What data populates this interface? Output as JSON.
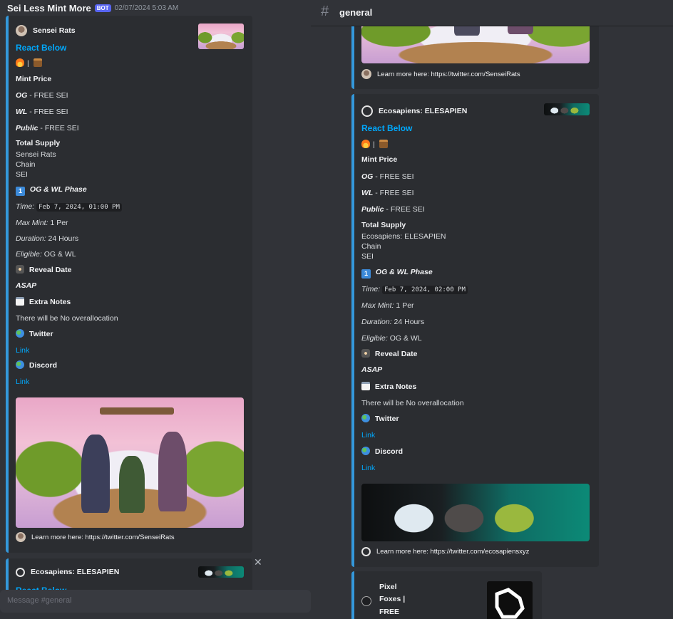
{
  "left_message": {
    "author": "Sei Less Mint More",
    "bot_tag": "BOT",
    "timestamp": "02/07/2024 5:03 AM"
  },
  "left_embed": {
    "author": "Sensei Rats",
    "title": "React Below",
    "reaction_line": "|",
    "mint_price_label": "Mint Price",
    "og_label": "OG",
    "og_value": " - FREE SEI",
    "wl_label": "WL",
    "wl_value": " - FREE SEI",
    "public_label": "Public",
    "public_value": " - FREE SEI",
    "total_supply_label": "Total Supply",
    "supply_lines": [
      "Sensei Rats",
      "Chain",
      "SEI"
    ],
    "phase_number": "1",
    "phase_label": "OG & WL Phase",
    "time_label": "Time:",
    "time_value": "Feb 7, 2024, 01:00 PM",
    "max_mint_label": "Max Mint:",
    "max_mint_value": " 1 Per",
    "duration_label": "Duration:",
    "duration_value": " 24 Hours",
    "eligible_label": "Eligible:",
    "eligible_value": " OG & WL",
    "reveal_label": "Reveal Date",
    "reveal_value": "ASAP",
    "notes_label": "Extra Notes",
    "notes_value": "There will be No overallocation",
    "twitter_label": "Twitter",
    "twitter_link": "Link",
    "discord_label": "Discord",
    "discord_link": "Link",
    "footer": "Learn more here: https://twitter.com/SenseiRats"
  },
  "left_second_embed": {
    "author": "Ecosapiens: ELESAPIEN",
    "title": "React Below"
  },
  "composer": {
    "placeholder": "Message #general"
  },
  "channel": {
    "name": "general"
  },
  "right_top_embed": {
    "footer": "Learn more here: https://twitter.com/SenseiRats"
  },
  "right_embed": {
    "author": "Ecosapiens: ELESAPIEN",
    "title": "React Below",
    "reaction_line": "|",
    "mint_price_label": "Mint Price",
    "og_label": "OG",
    "og_value": " - FREE SEI",
    "wl_label": "WL",
    "wl_value": " - FREE SEI",
    "public_label": "Public",
    "public_value": " - FREE SEI",
    "total_supply_label": "Total Supply",
    "supply_lines": [
      "Ecosapiens: ELESAPIEN",
      "Chain",
      "SEI"
    ],
    "phase_number": "1",
    "phase_label": "OG & WL Phase",
    "time_label": "Time:",
    "time_value": "Feb 7, 2024, 02:00 PM",
    "max_mint_label": "Max Mint:",
    "max_mint_value": " 1 Per",
    "duration_label": "Duration:",
    "duration_value": " 24 Hours",
    "eligible_label": "Eligible:",
    "eligible_value": " OG & WL",
    "reveal_label": "Reveal Date",
    "reveal_value": "ASAP",
    "notes_label": "Extra Notes",
    "notes_value": "There will be No overallocation",
    "twitter_label": "Twitter",
    "twitter_link": "Link",
    "discord_label": "Discord",
    "discord_link": "Link",
    "footer": "Learn more here: https://twitter.com/ecosapiensxyz"
  },
  "right_bottom_embed": {
    "author_lines": [
      "Pixel",
      "Foxes |",
      "FREE"
    ]
  }
}
